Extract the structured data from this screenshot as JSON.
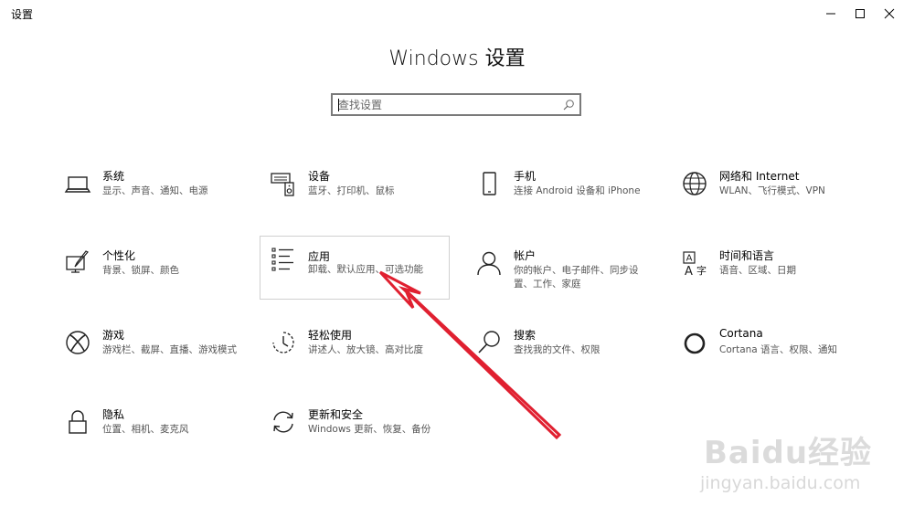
{
  "window": {
    "title": "设置"
  },
  "header": {
    "title": "Windows 设置"
  },
  "search": {
    "placeholder": "查找设置"
  },
  "tiles": [
    {
      "title": "系统",
      "desc": "显示、声音、通知、电源",
      "icon": "laptop-icon"
    },
    {
      "title": "设备",
      "desc": "蓝牙、打印机、鼠标",
      "icon": "devices-icon"
    },
    {
      "title": "手机",
      "desc": "连接 Android 设备和 iPhone",
      "icon": "phone-icon"
    },
    {
      "title": "网络和 Internet",
      "desc": "WLAN、飞行模式、VPN",
      "icon": "globe-icon"
    },
    {
      "title": "个性化",
      "desc": "背景、锁屏、颜色",
      "icon": "personalization-icon"
    },
    {
      "title": "应用",
      "desc": "卸载、默认应用、可选功能",
      "icon": "apps-list-icon"
    },
    {
      "title": "帐户",
      "desc": "你的帐户、电子邮件、同步设置、工作、家庭",
      "icon": "person-icon"
    },
    {
      "title": "时间和语言",
      "desc": "语音、区域、日期",
      "icon": "time-language-icon"
    },
    {
      "title": "游戏",
      "desc": "游戏栏、截屏、直播、游戏模式",
      "icon": "xbox-icon"
    },
    {
      "title": "轻松使用",
      "desc": "讲述人、放大镜、高对比度",
      "icon": "ease-of-access-icon"
    },
    {
      "title": "搜索",
      "desc": "查找我的文件、权限",
      "icon": "search-magnifier-icon"
    },
    {
      "title": "Cortana",
      "desc": "Cortana 语言、权限、通知",
      "icon": "cortana-ring-icon"
    },
    {
      "title": "隐私",
      "desc": "位置、相机、麦克风",
      "icon": "lock-icon"
    },
    {
      "title": "更新和安全",
      "desc": "Windows 更新、恢复、备份",
      "icon": "sync-icon"
    }
  ],
  "watermark": {
    "brand": "Baidu经验",
    "url": "jingyan.baidu.com"
  },
  "colors": {
    "arrow": "#e02030",
    "hover_border": "#d0d0d0"
  }
}
